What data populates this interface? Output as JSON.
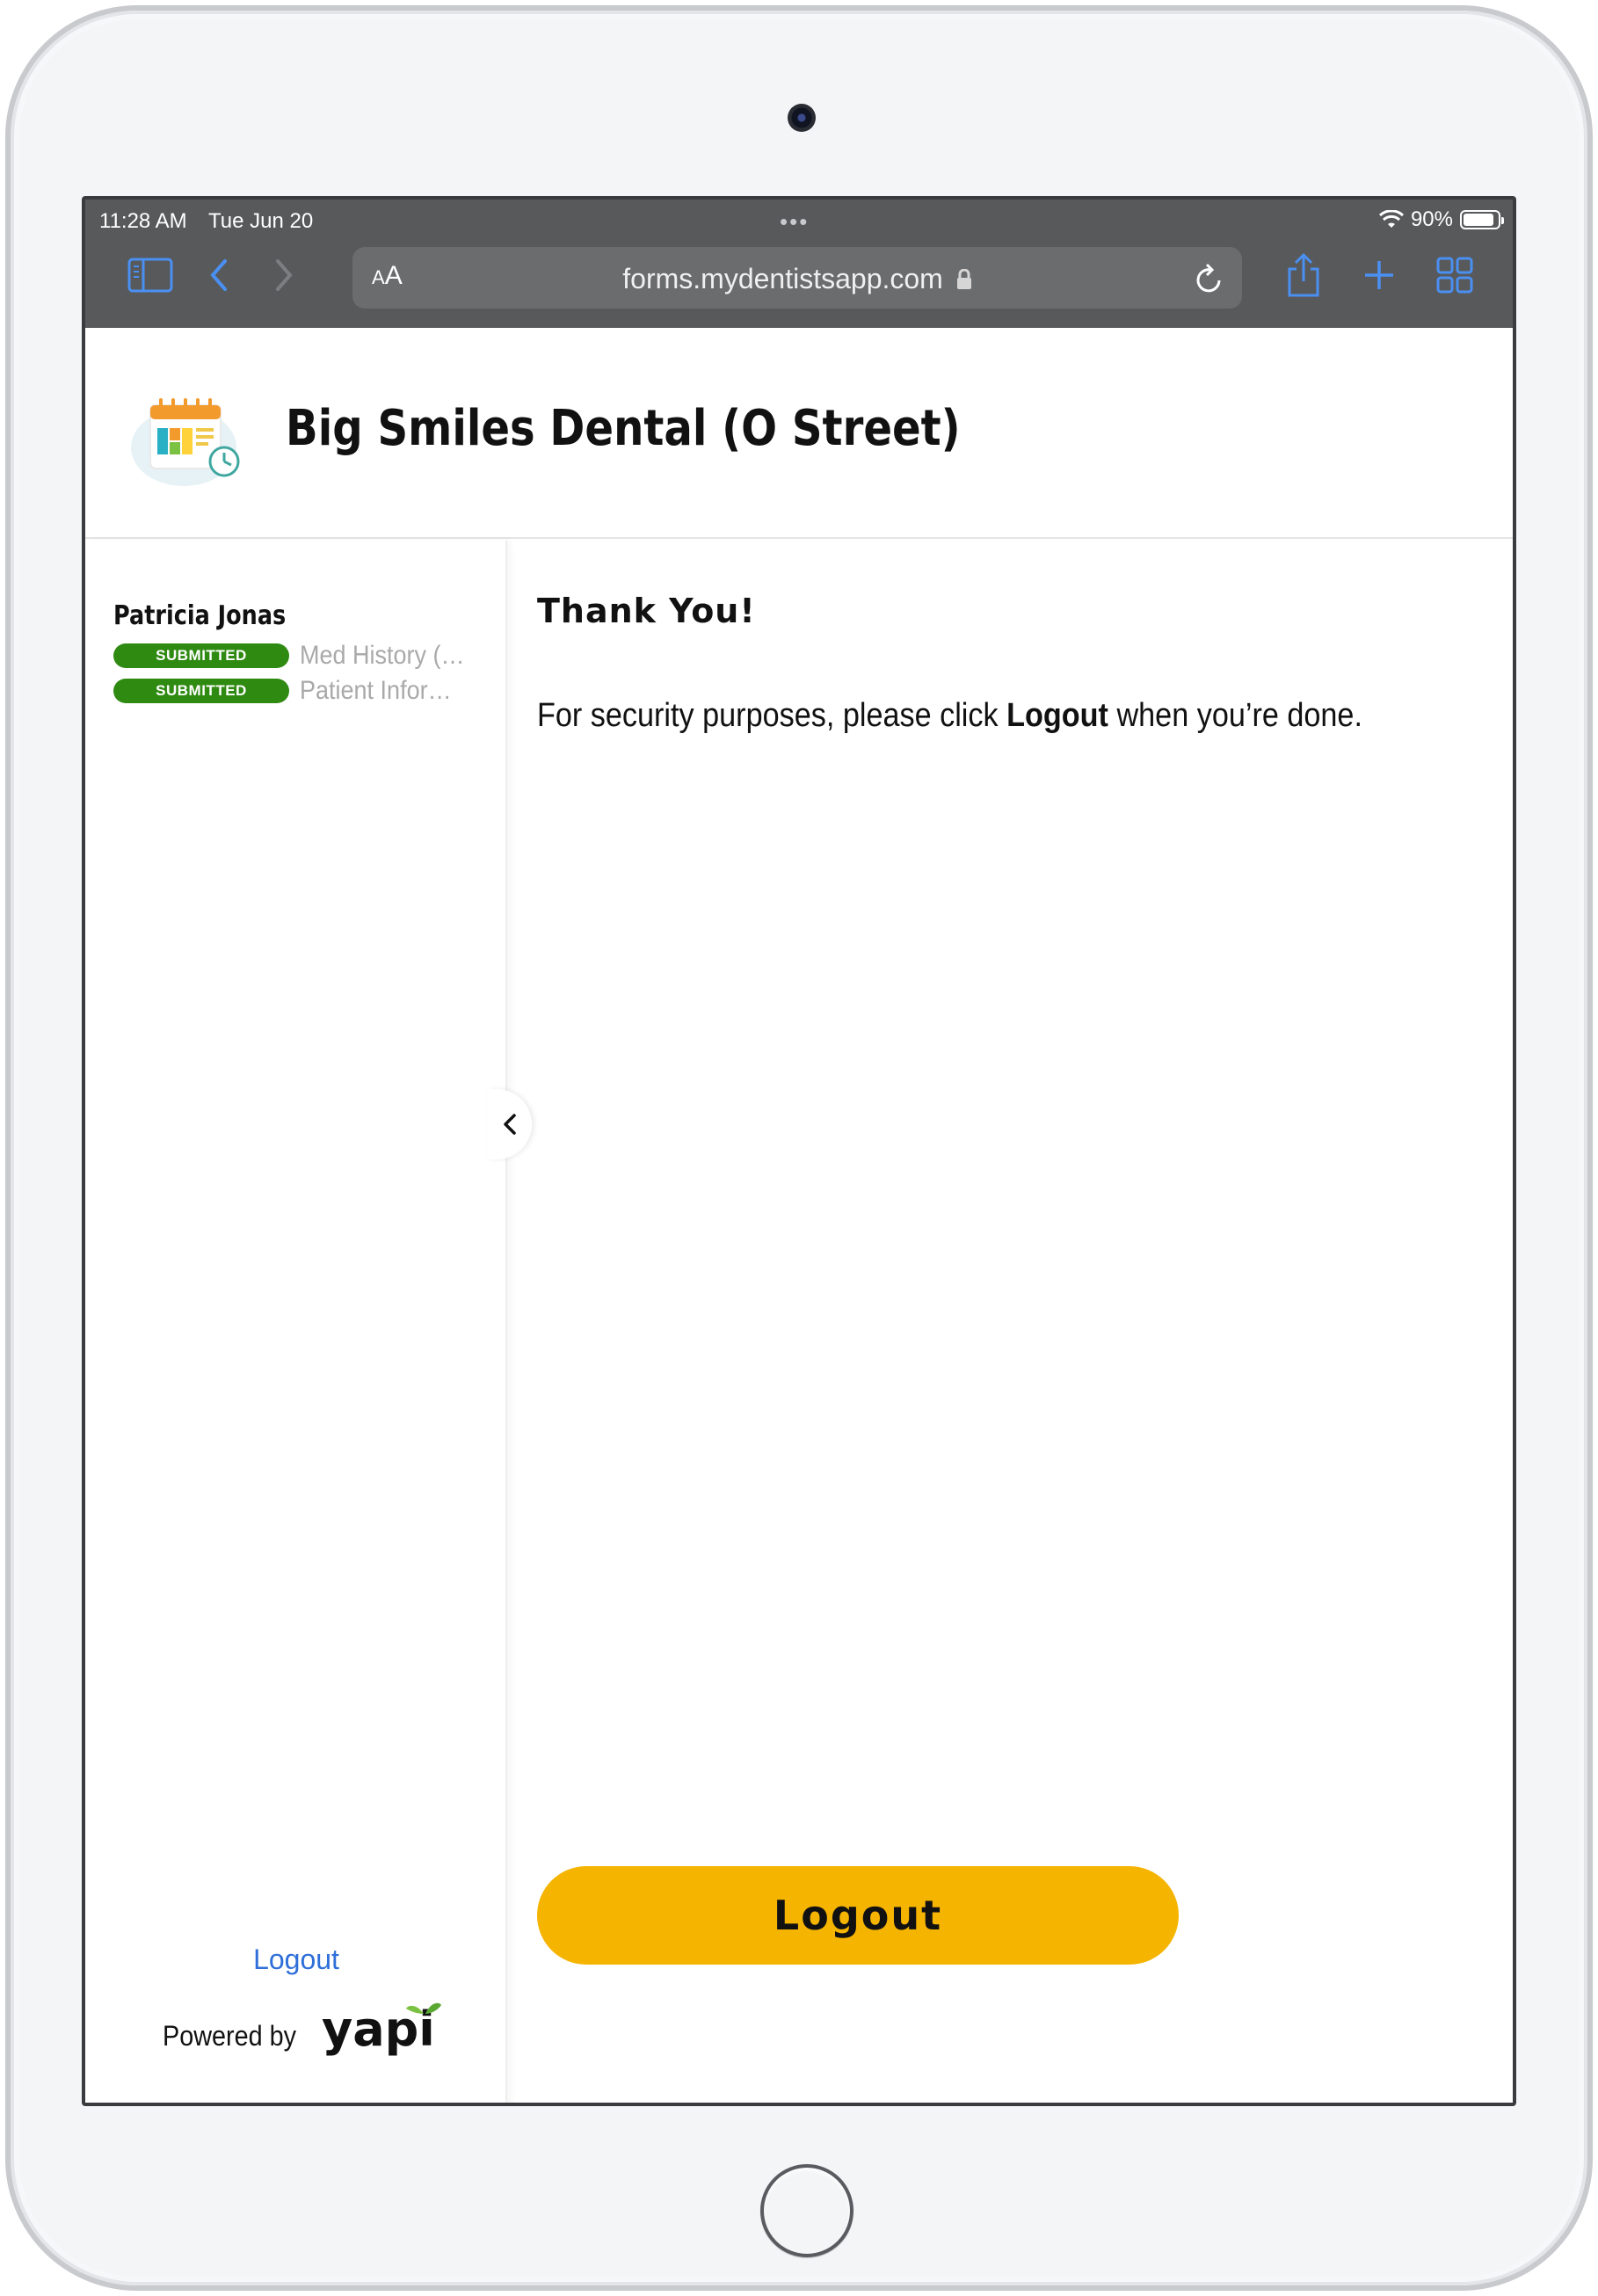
{
  "status_bar": {
    "time": "11:28 AM",
    "date": "Tue Jun 20",
    "battery": "90%",
    "battery_level": 0.9
  },
  "toolbar": {
    "text_size_label": "AA",
    "url": "forms.mydentistsapp.com",
    "accent_color": "#4a90f2"
  },
  "header": {
    "clinic_name": "Big Smiles Dental (O Street)"
  },
  "sidebar": {
    "patient_name": "Patricia Jonas",
    "forms": [
      {
        "status": "SUBMITTED",
        "name": "Med History (A..."
      },
      {
        "status": "SUBMITTED",
        "name": "Patient Inform..."
      }
    ],
    "logout_label": "Logout",
    "powered_by": "Powered by",
    "brand": "yapi"
  },
  "main": {
    "title": "Thank You!",
    "message_before": "For security purposes, please click ",
    "message_bold": "Logout",
    "message_after": " when you’re done.",
    "logout_button": "Logout",
    "button_color": "#f5b400"
  }
}
